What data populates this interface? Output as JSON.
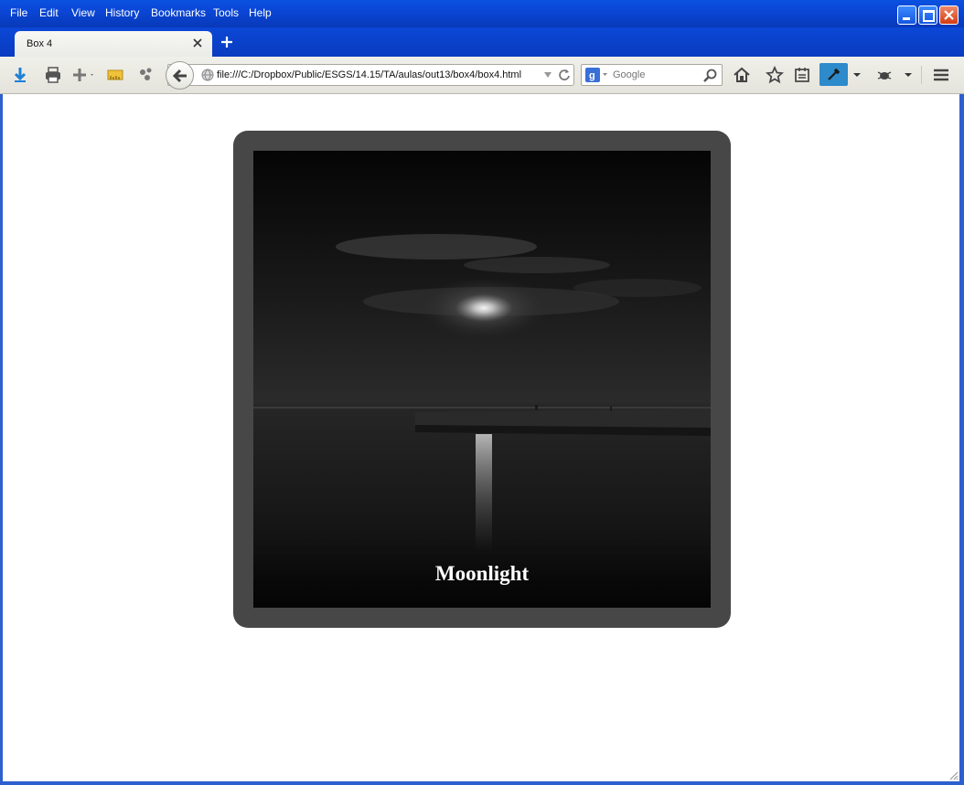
{
  "menubar": {
    "items": [
      {
        "label": "File"
      },
      {
        "label": "Edit"
      },
      {
        "label": "View"
      },
      {
        "label": "History"
      },
      {
        "label": "Bookmarks"
      },
      {
        "label": "Tools"
      },
      {
        "label": "Help"
      }
    ]
  },
  "tab": {
    "title": "Box 4"
  },
  "navbar": {
    "url": "file:///C:/Dropbox/Public/ESGS/14.15/TA/aulas/out13/box4/box4.html",
    "search_placeholder": "Google"
  },
  "page": {
    "caption": "Moonlight"
  },
  "colors": {
    "box_border": "#474747",
    "accent": "#2d8acb",
    "window_blue": "#0a46d6"
  },
  "icons": [
    "download-icon",
    "print-icon",
    "add-icon",
    "ruler-icon",
    "share-icon",
    "back-icon",
    "globe-icon",
    "dropdown-icon",
    "reload-icon",
    "google-icon",
    "search-icon",
    "home-icon",
    "star-icon",
    "reader-icon",
    "eyedropper-icon",
    "bug-icon",
    "menu-icon"
  ]
}
